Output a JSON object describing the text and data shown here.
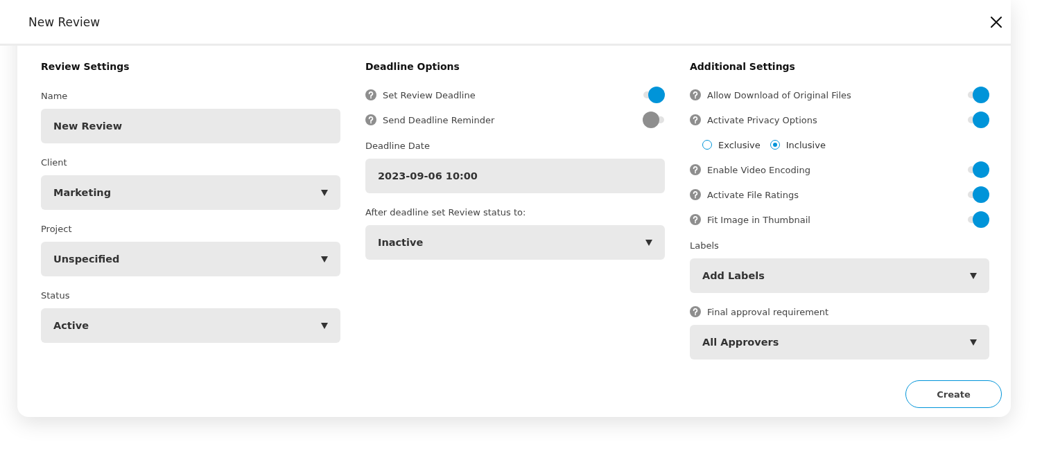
{
  "dialog": {
    "title": "New Review"
  },
  "columns": [
    {
      "heading": "Review Settings",
      "items": [
        {
          "kind": "label",
          "text": "Name",
          "help": false
        },
        {
          "kind": "input",
          "value": "New Review"
        },
        {
          "kind": "label",
          "text": "Client",
          "help": false
        },
        {
          "kind": "select",
          "value": "Marketing"
        },
        {
          "kind": "label",
          "text": "Project",
          "help": false
        },
        {
          "kind": "select",
          "value": "Unspecified"
        },
        {
          "kind": "label",
          "text": "Status",
          "help": false
        },
        {
          "kind": "select",
          "value": "Active"
        }
      ]
    },
    {
      "heading": "Deadline Options",
      "items": [
        {
          "kind": "toggle",
          "label": "Set Review Deadline",
          "on": true
        },
        {
          "kind": "toggle",
          "label": "Send Deadline Reminder",
          "on": false
        },
        {
          "kind": "label",
          "text": "Deadline Date",
          "help": false
        },
        {
          "kind": "input",
          "value": "2023-09-06 10:00"
        },
        {
          "kind": "label",
          "text": "After deadline set Review status to:",
          "help": false
        },
        {
          "kind": "select",
          "value": "Inactive"
        }
      ]
    },
    {
      "heading": "Additional Settings",
      "items": [
        {
          "kind": "toggle",
          "label": "Allow Download of Original Files",
          "on": true
        },
        {
          "kind": "toggle",
          "label": "Activate Privacy Options",
          "on": true
        },
        {
          "kind": "radios",
          "options": [
            {
              "label": "Exclusive",
              "selected": false
            },
            {
              "label": "Inclusive",
              "selected": true
            }
          ]
        },
        {
          "kind": "toggle",
          "label": "Enable Video Encoding",
          "on": true
        },
        {
          "kind": "toggle",
          "label": "Activate File Ratings",
          "on": true
        },
        {
          "kind": "toggle",
          "label": "Fit Image in Thumbnail",
          "on": true
        },
        {
          "kind": "label",
          "text": "Labels",
          "help": false
        },
        {
          "kind": "select",
          "value": "Add Labels"
        },
        {
          "kind": "label",
          "text": "Final approval requirement",
          "help": true
        },
        {
          "kind": "select",
          "value": "All Approvers"
        }
      ]
    }
  ],
  "footer": {
    "button": "Create"
  }
}
